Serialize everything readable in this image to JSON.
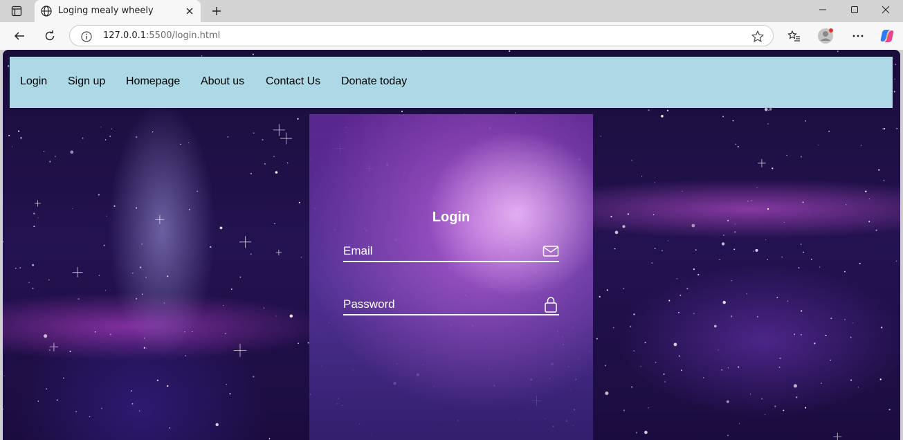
{
  "browser": {
    "tab_title": "Loging mealy wheely",
    "url_host": "127.0.0.1",
    "url_rest": ":5500/login.html"
  },
  "navbar": {
    "items": [
      {
        "label": "Login"
      },
      {
        "label": "Sign up"
      },
      {
        "label": "Homepage"
      },
      {
        "label": "About us"
      },
      {
        "label": "Contact Us"
      },
      {
        "label": "Donate today"
      }
    ]
  },
  "login": {
    "title": "Login",
    "email_label": "Email",
    "password_label": "Password",
    "email_icon": "envelope-icon",
    "password_icon": "lock-icon"
  },
  "colors": {
    "navbar_bg": "#add8e6",
    "form_text": "#ffffff"
  }
}
